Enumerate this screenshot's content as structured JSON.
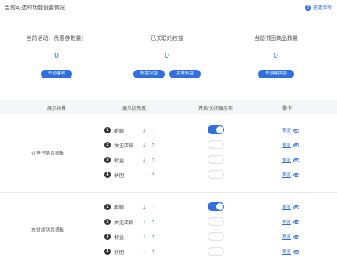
{
  "header": {
    "title": "当前可选的功能设置情况",
    "help_label": "查看帮助",
    "help_icon": "question-circle-icon"
  },
  "stats": [
    {
      "label": "当前活动、优惠券数量：",
      "value": "0",
      "buttons": [
        "去创建吧"
      ]
    },
    {
      "label": "已关联的权益",
      "value": "0",
      "buttons": [
        "配置权益",
        "关联权益"
      ]
    },
    {
      "label": "当前拼团商品数量",
      "value": "0",
      "buttons": [
        "去创建拼团"
      ]
    }
  ],
  "table": {
    "headers": [
      "展示场景",
      "展示优先级",
      "开启/关闭展示项",
      "操作"
    ],
    "groups": [
      {
        "scene": "订单详情页模板",
        "rows": [
          {
            "index": "1",
            "name": "群聊",
            "enabled": true,
            "preview": "预览"
          },
          {
            "index": "2",
            "name": "关注店铺",
            "enabled": false,
            "preview": "预览"
          },
          {
            "index": "3",
            "name": "权益",
            "enabled": false,
            "preview": "预览"
          },
          {
            "index": "4",
            "name": "拼团",
            "enabled": false,
            "preview": "预览"
          }
        ]
      },
      {
        "scene": "支付成功页模板",
        "rows": [
          {
            "index": "1",
            "name": "群聊",
            "enabled": true,
            "preview": "预览"
          },
          {
            "index": "2",
            "name": "关注店铺",
            "enabled": false,
            "preview": "预览"
          },
          {
            "index": "3",
            "name": "权益",
            "enabled": false,
            "preview": "预览"
          },
          {
            "index": "4",
            "name": "拼团",
            "enabled": false,
            "preview": "预览"
          }
        ]
      }
    ]
  },
  "colors": {
    "accent": "#2f6fe0",
    "disabled_arrow": "#d3d8e0"
  }
}
